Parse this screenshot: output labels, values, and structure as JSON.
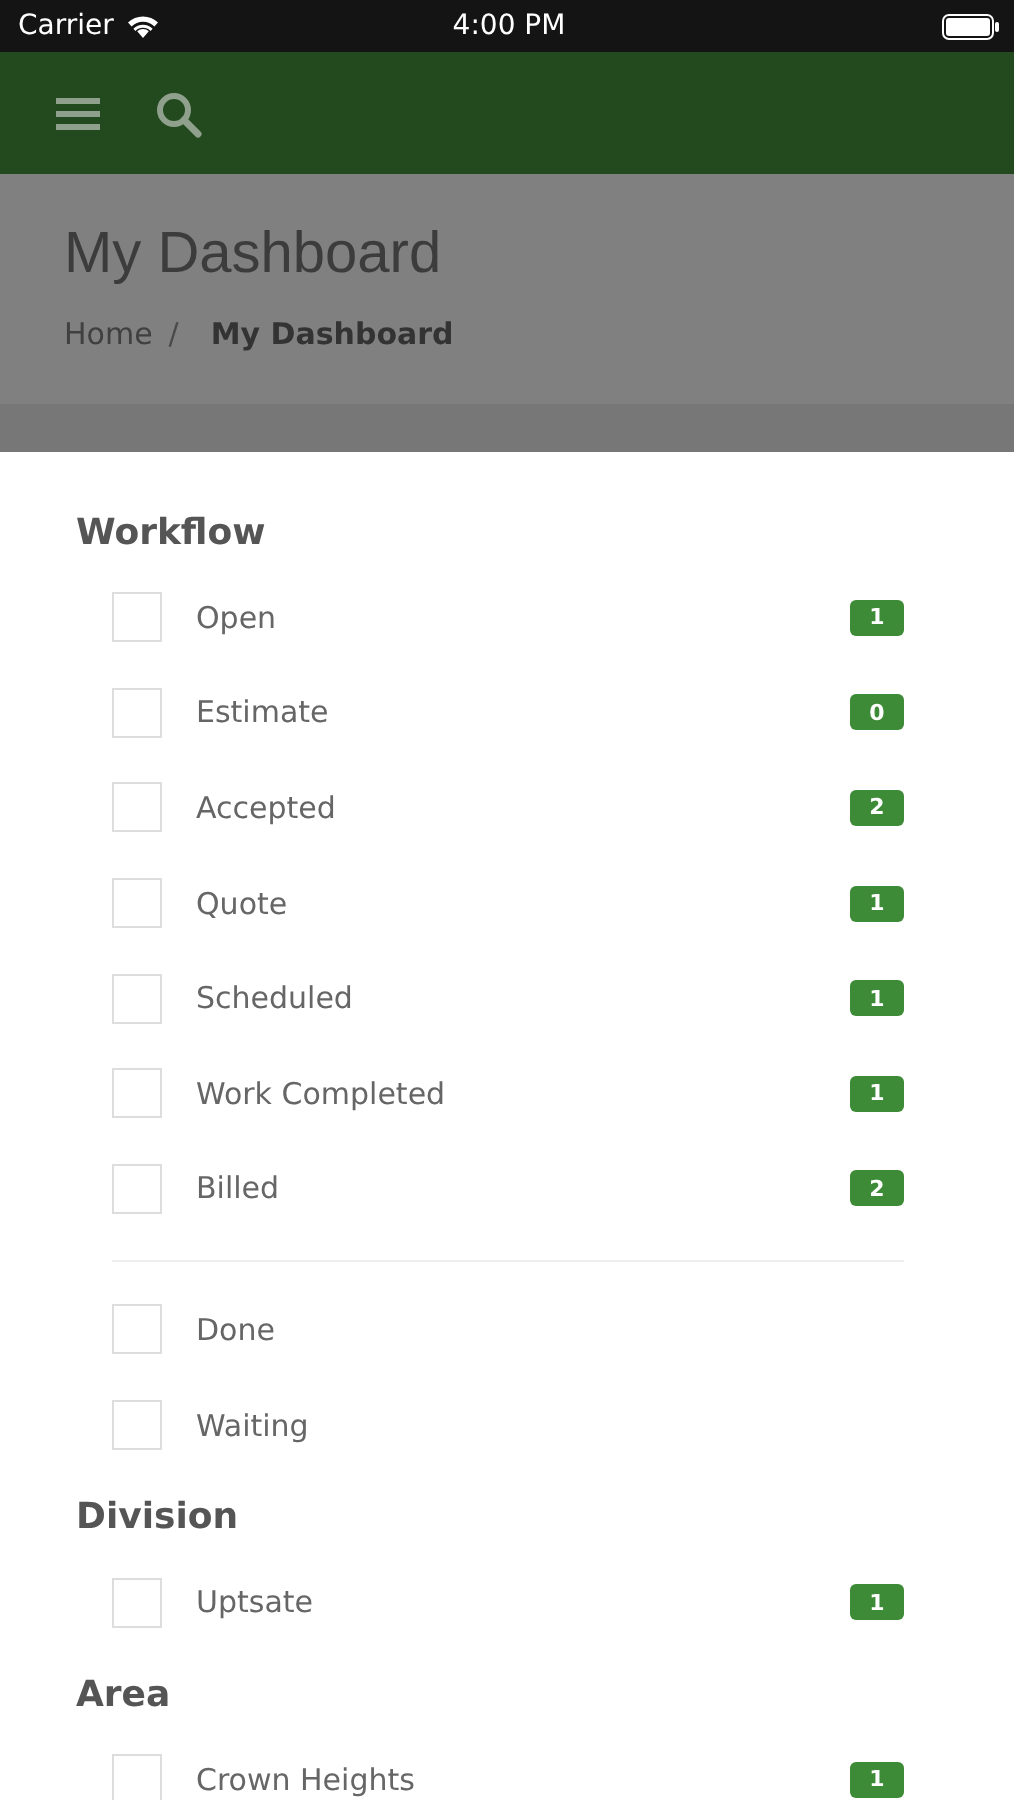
{
  "status_bar": {
    "carrier": "Carrier",
    "time": "4:00 PM"
  },
  "header": {
    "title": "My Dashboard",
    "separator": "/",
    "breadcrumbs": [
      {
        "label": "Home",
        "current": false
      },
      {
        "label": "My Dashboard",
        "current": true
      }
    ]
  },
  "sections": [
    {
      "title": "Workflow",
      "groups": [
        {
          "items": [
            {
              "label": "Open",
              "checked": false,
              "count": "1"
            },
            {
              "label": "Estimate",
              "checked": false,
              "count": "0"
            },
            {
              "label": "Accepted",
              "checked": false,
              "count": "2"
            },
            {
              "label": "Quote",
              "checked": false,
              "count": "1"
            },
            {
              "label": "Scheduled",
              "checked": false,
              "count": "1"
            },
            {
              "label": "Work Completed",
              "checked": false,
              "count": "1"
            },
            {
              "label": "Billed",
              "checked": false,
              "count": "2"
            }
          ]
        },
        {
          "items": [
            {
              "label": "Done",
              "checked": false
            },
            {
              "label": "Waiting",
              "checked": false
            }
          ]
        }
      ]
    },
    {
      "title": "Division",
      "groups": [
        {
          "items": [
            {
              "label": "Uptsate",
              "checked": false,
              "count": "1"
            }
          ]
        }
      ]
    },
    {
      "title": "Area",
      "groups": [
        {
          "items": [
            {
              "label": "Crown Heights",
              "checked": false,
              "count": "1"
            }
          ]
        }
      ]
    }
  ]
}
